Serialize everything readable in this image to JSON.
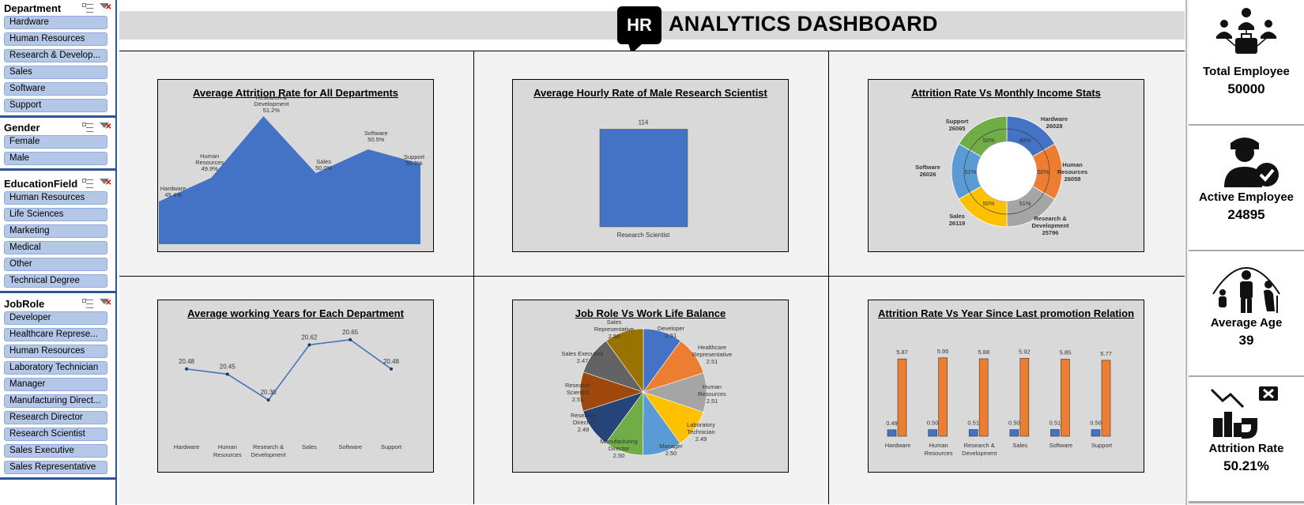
{
  "header": {
    "logo": "HR",
    "title": "ANALYTICS DASHBOARD"
  },
  "slicers": [
    {
      "title": "Department",
      "items": [
        "Hardware",
        "Human Resources",
        "Research & Develop...",
        "Sales",
        "Software",
        "Support"
      ]
    },
    {
      "title": "Gender",
      "items": [
        "Female",
        "Male"
      ]
    },
    {
      "title": "EducationField",
      "items": [
        "Human Resources",
        "Life Sciences",
        "Marketing",
        "Medical",
        "Other",
        "Technical Degree"
      ]
    },
    {
      "title": "JobRole",
      "items": [
        "Developer",
        "Healthcare Represe...",
        "Human Resources",
        "Laboratory Technician",
        "Manager",
        "Manufacturing Direct...",
        "Research Director",
        "Research Scientist",
        "Sales Executive",
        "Sales Representative"
      ]
    }
  ],
  "kpis": [
    {
      "label": "Total Employee",
      "value": "50000",
      "icon": "team-briefcase-icon"
    },
    {
      "label": "Active Employee",
      "value": "24895",
      "icon": "user-check-icon"
    },
    {
      "label": "Average Age",
      "value": "39",
      "icon": "age-group-icon"
    },
    {
      "label": "Attrition Rate",
      "value": "50.21%",
      "icon": "attrition-decline-icon"
    }
  ],
  "chart_data": [
    {
      "type": "area",
      "title": "Average Attrition Rate for All Departments",
      "categories": [
        "Hardware",
        "Human Resources",
        "Research & Development",
        "Sales",
        "Software",
        "Support"
      ],
      "values": [
        49.4,
        49.9,
        51.2,
        50.0,
        50.5,
        50.2
      ],
      "labels": [
        "49.4%",
        "49.9%",
        "51.2%",
        "50.0%",
        "50.5%",
        "50.2%"
      ],
      "color": "#4472C4"
    },
    {
      "type": "bar",
      "title": "Average Hourly Rate of Male Research Scientist",
      "categories": [
        "Research Scientist"
      ],
      "values": [
        114
      ],
      "labels": [
        "114"
      ],
      "color": "#4472C4"
    },
    {
      "type": "pie",
      "title": "Attrition Rate Vs Monthly Income Stats",
      "categories": [
        "Hardware",
        "Human Resources",
        "Research & Development",
        "Sales",
        "Software",
        "Support"
      ],
      "income": [
        26028,
        26058,
        25796,
        26119,
        26026,
        26065
      ],
      "attrition_labels": [
        "49%",
        "50%",
        "51%",
        "50%",
        "51%",
        "50%"
      ],
      "colors": [
        "#4472C4",
        "#ED7D31",
        "#A5A5A5",
        "#FFC000",
        "#5B9BD5",
        "#70AD47"
      ]
    },
    {
      "type": "line",
      "title": "Average working Years for Each Department",
      "categories": [
        "Hardware",
        "Human Resources",
        "Research & Development",
        "Sales",
        "Software",
        "Support"
      ],
      "values": [
        20.48,
        20.45,
        20.3,
        20.62,
        20.65,
        20.48
      ],
      "labels": [
        "20.48",
        "20.45",
        "20.30",
        "20.62",
        "20.65",
        "20.48"
      ],
      "color": "#4472C4"
    },
    {
      "type": "pie",
      "title": "Job Role Vs Work Life Balance",
      "categories": [
        "Developer",
        "Healthcare Representative",
        "Human Resources",
        "Laboratory Technician",
        "Manager",
        "Manufacturing Director",
        "Research Director",
        "Research Scientist",
        "Sales Executive",
        "Sales Representative"
      ],
      "values": [
        2.51,
        2.51,
        2.51,
        2.49,
        2.5,
        2.5,
        2.49,
        2.51,
        2.47,
        2.5
      ],
      "labels": [
        "2.51",
        "2.51",
        "2.51",
        "2.49",
        "2.50",
        "2.50",
        "2.49",
        "2.51",
        "2.47",
        "2.50"
      ],
      "colors": [
        "#4472C4",
        "#ED7D31",
        "#A5A5A5",
        "#FFC000",
        "#5B9BD5",
        "#70AD47",
        "#264478",
        "#9E480E",
        "#636363",
        "#997300"
      ]
    },
    {
      "type": "bar",
      "title": "Attrition Rate Vs Year Since Last promotion Relation",
      "categories": [
        "Hardware",
        "Human Resources",
        "Research & Development",
        "Sales",
        "Software",
        "Support"
      ],
      "series": [
        {
          "values": [
            0.49,
            0.5,
            0.51,
            0.5,
            0.51,
            0.5
          ],
          "labels": [
            "0.49",
            "0.50",
            "0.51",
            "0.50",
            "0.51",
            "0.50"
          ],
          "color": "#4472C4"
        },
        {
          "values": [
            5.87,
            5.95,
            5.88,
            5.92,
            5.85,
            5.77
          ],
          "labels": [
            "5.87",
            "5.95",
            "5.88",
            "5.92",
            "5.85",
            "5.77"
          ],
          "color": "#ED7D31"
        }
      ]
    }
  ]
}
